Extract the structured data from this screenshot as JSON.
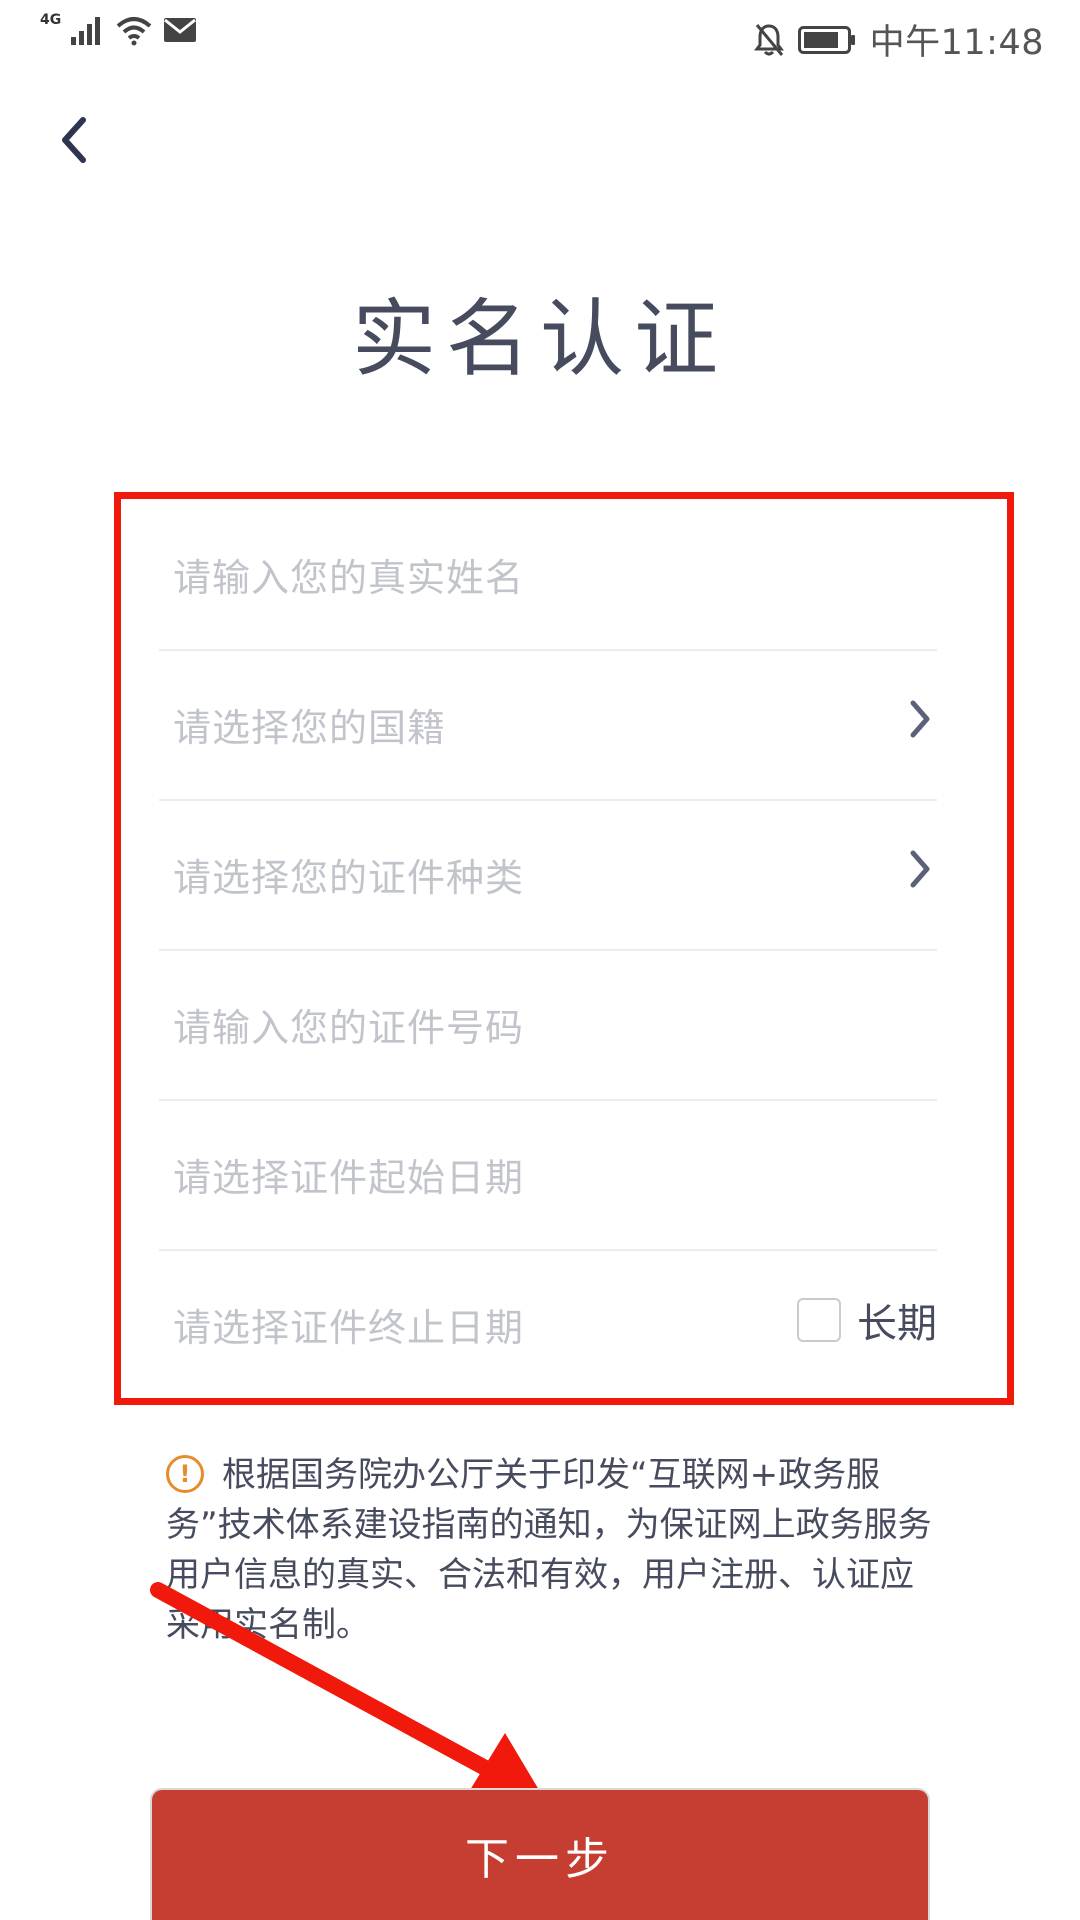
{
  "status_bar": {
    "network": "4G",
    "time": "中午11:48",
    "icons": [
      "signal-icon",
      "wifi-icon",
      "mail-icon",
      "mute-bell-icon",
      "battery-icon"
    ]
  },
  "header": {
    "back_icon": "chevron-left-icon",
    "title": "实名认证"
  },
  "form": {
    "highlight_color": "#f0190c",
    "fields": [
      {
        "placeholder": "请输入您的真实姓名",
        "type": "input"
      },
      {
        "placeholder": "请选择您的国籍",
        "type": "select"
      },
      {
        "placeholder": "请选择您的证件种类",
        "type": "select"
      },
      {
        "placeholder": "请输入您的证件号码",
        "type": "input"
      },
      {
        "placeholder": "请选择证件起始日期",
        "type": "date"
      },
      {
        "placeholder": "请选择证件终止日期",
        "type": "date"
      }
    ],
    "long_term_label": "长期",
    "long_term_checked": false
  },
  "notice": {
    "icon": "warning-circle-icon",
    "text": "根据国务院办公厅关于印发“互联网+政务服务”技术体系建设指南的通知，为保证网上政务服务用户信息的真实、合法和有效，用户注册、认证应采用实名制。"
  },
  "next_button": {
    "label": "下一步",
    "color": "#c63d32"
  },
  "annotation_arrow_color": "#f0190c"
}
